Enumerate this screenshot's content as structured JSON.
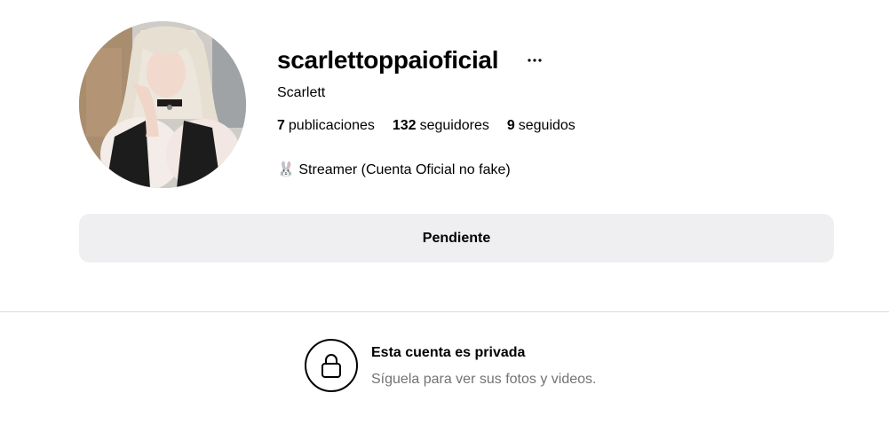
{
  "profile": {
    "username": "scarlettoppaioficial",
    "full_name": "Scarlett",
    "bio": "🐰 Streamer (Cuenta Oficial no fake)",
    "avatar_icon": "profile-photo"
  },
  "stats": [
    {
      "count": "7",
      "label": "publicaciones"
    },
    {
      "count": "132",
      "label": "seguidores"
    },
    {
      "count": "9",
      "label": "seguidos"
    }
  ],
  "actions": {
    "follow_status_label": "Pendiente",
    "options_icon": "more-horizontal-icon"
  },
  "private_notice": {
    "icon": "lock-icon",
    "title": "Esta cuenta es privada",
    "subtitle": "Síguela para ver sus fotos y videos."
  },
  "colors": {
    "button_bg": "#efeff2",
    "divider": "#dbdbdb",
    "secondary_text": "#737373"
  }
}
